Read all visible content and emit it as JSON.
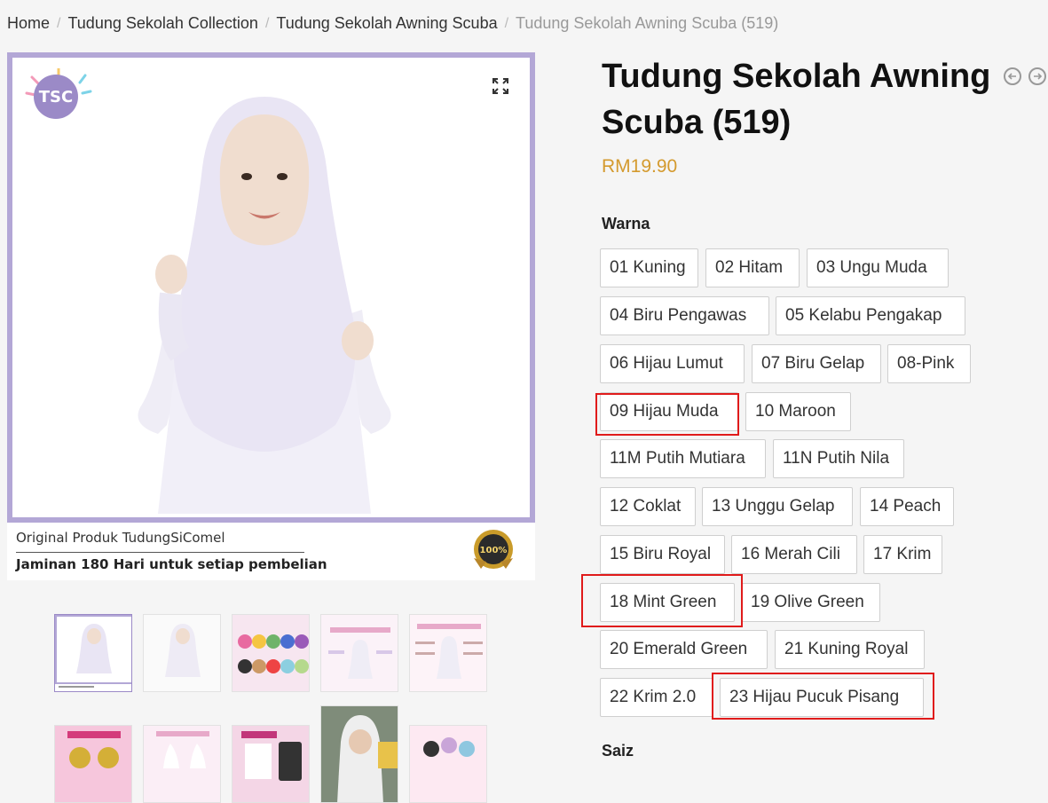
{
  "breadcrumb": {
    "home": "Home",
    "collection": "Tudung Sekolah Collection",
    "category": "Tudung Sekolah Awning Scuba",
    "current": "Tudung Sekolah Awning Scuba (519)"
  },
  "product": {
    "title": "Tudung Sekolah Awning Scuba (519)",
    "price": "RM19.90",
    "brand_logo": "TSC",
    "caption_line1": "Original Produk TudungSiComel",
    "caption_line2": "Jaminan 180 Hari untuk setiap pembelian",
    "badge_text": "100%"
  },
  "options": {
    "warna_label": "Warna",
    "saiz_label": "Saiz",
    "colors": [
      "01 Kuning",
      "02 Hitam",
      "03 Ungu Muda",
      "04 Biru Pengawas",
      "05 Kelabu Pengakap",
      "06 Hijau Lumut",
      "07 Biru Gelap",
      "08-Pink",
      "09 Hijau Muda",
      "10 Maroon",
      "11M Putih Mutiara",
      "11N Putih Nila",
      "12 Coklat",
      "13 Unggu Gelap",
      "14 Peach",
      "15 Biru Royal",
      "16 Merah Cili",
      "17 Krim",
      "18 Mint Green",
      "19 Olive Green",
      "20 Emerald Green",
      "21 Kuning Royal",
      "22 Krim 2.0",
      "23 Hijau Pucuk Pisang"
    ],
    "highlighted": [
      "09 Hijau Muda",
      "18 Mint Green",
      "23 Hijau Pucuk Pisang"
    ]
  },
  "icons": {
    "expand": "expand-icon",
    "prev": "arrow-left-circle-icon",
    "next": "arrow-right-circle-icon"
  },
  "colors": {
    "accent_price": "#d49a2e",
    "frame": "#b3a7d6",
    "highlight": "#e01b1b"
  }
}
